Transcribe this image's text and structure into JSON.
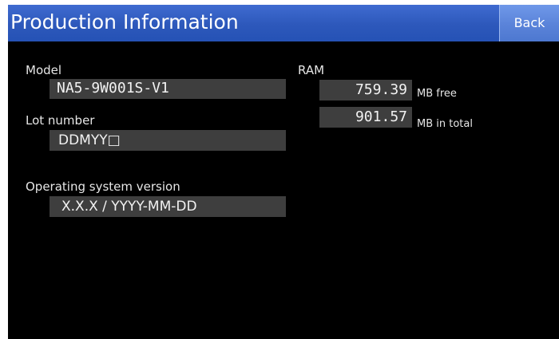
{
  "header": {
    "title": "Production Information",
    "back_label": "Back"
  },
  "model": {
    "label": "Model",
    "value": "NA5-9W001S-V1"
  },
  "lot": {
    "label": "Lot number",
    "value": "DDMYY□"
  },
  "os": {
    "label": "Operating system version",
    "value": "X.X.X / YYYY-MM-DD"
  },
  "ram": {
    "label": "RAM",
    "free_value": "759.39",
    "free_unit": "MB free",
    "total_value": "901.57",
    "total_unit": "MB in total"
  },
  "colors": {
    "title_bar": "#2d58bb",
    "back_button": "#5a83d9",
    "background": "#000000",
    "field": "#3e3e3e"
  }
}
